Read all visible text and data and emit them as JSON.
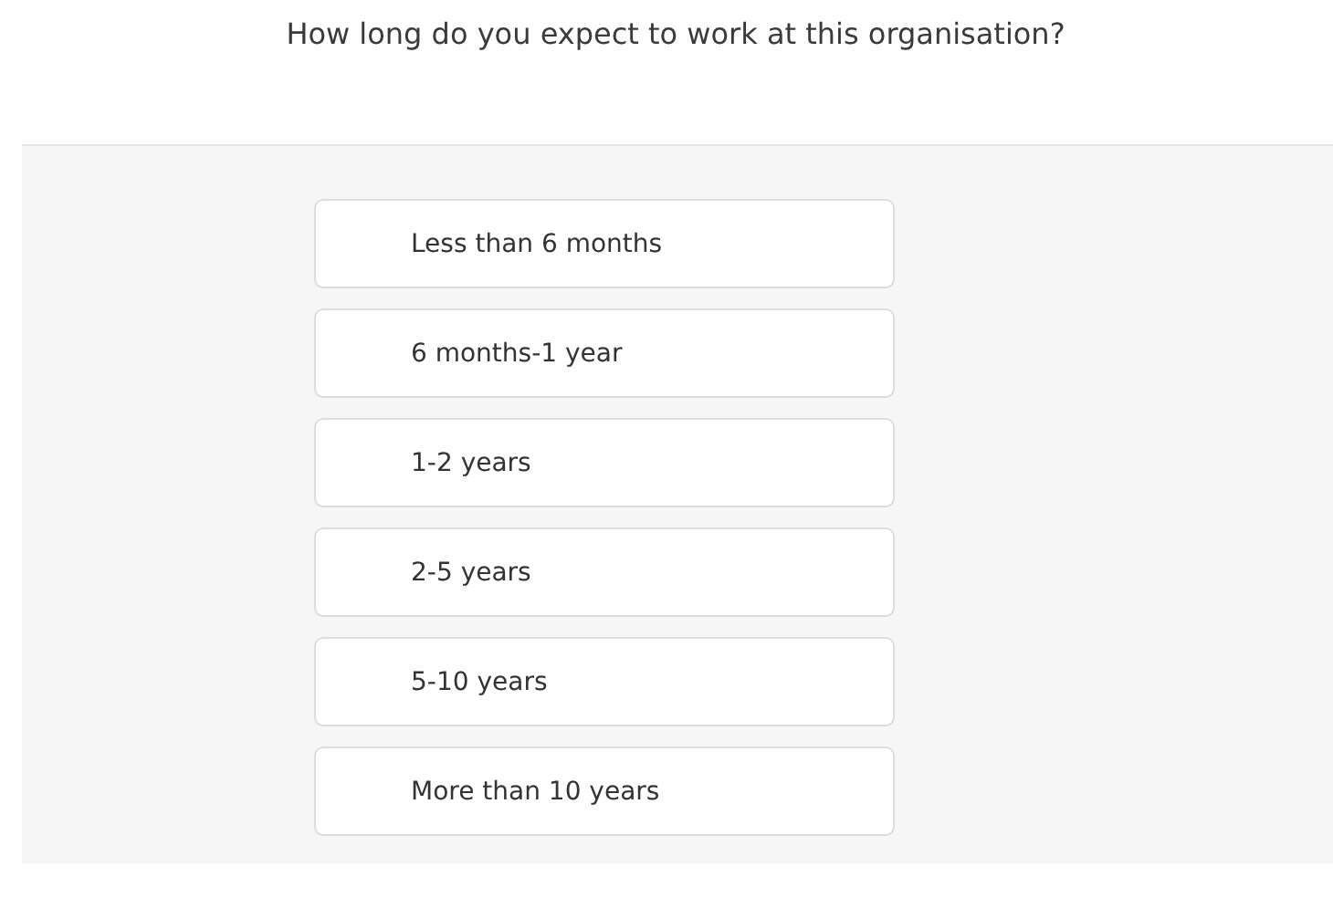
{
  "question": "How long do you expect to work at this organisation?",
  "options": [
    {
      "label": "Less than 6 months"
    },
    {
      "label": "6 months-1 year"
    },
    {
      "label": "1-2 years"
    },
    {
      "label": "2-5 years"
    },
    {
      "label": "5-10 years"
    },
    {
      "label": "More than 10 years"
    }
  ]
}
